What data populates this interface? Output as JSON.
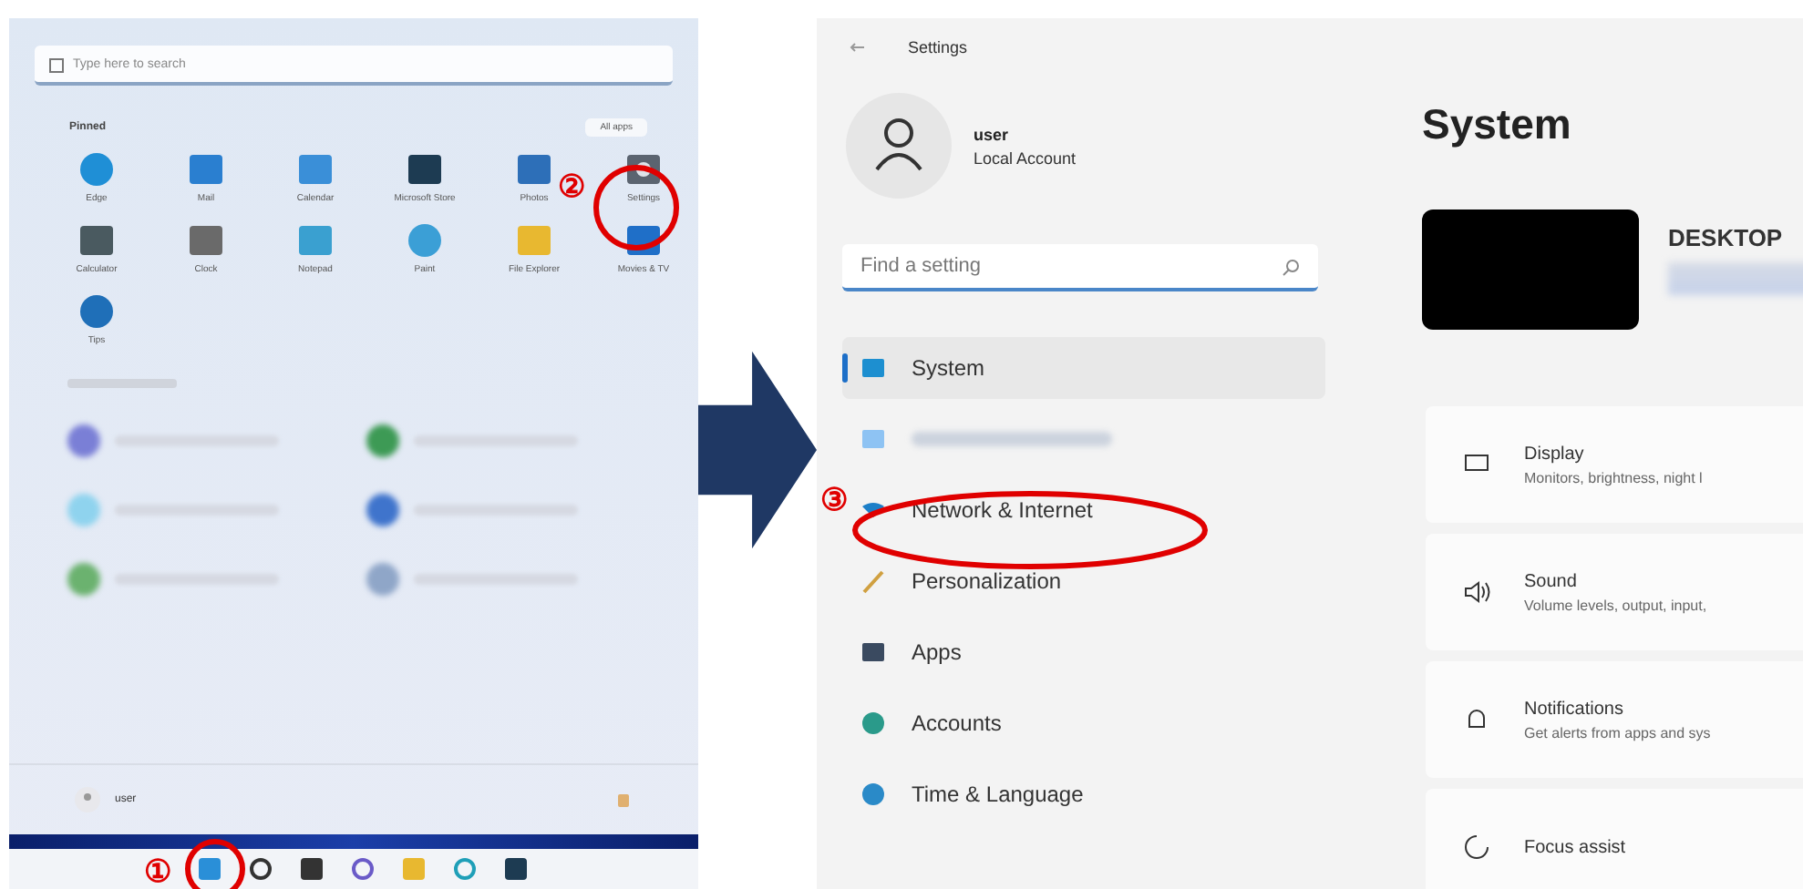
{
  "start_menu": {
    "search": {
      "placeholder": "Type here to search"
    },
    "pinned_title": "Pinned",
    "all_apps": "All apps",
    "apps": [
      {
        "label": "Edge",
        "kind": "edge"
      },
      {
        "label": "Mail",
        "kind": "mail"
      },
      {
        "label": "Calendar",
        "kind": "calendar"
      },
      {
        "label": "Microsoft Store",
        "kind": "store"
      },
      {
        "label": "Photos",
        "kind": "photos"
      },
      {
        "label": "Settings",
        "kind": "settings"
      },
      {
        "label": "Calculator",
        "kind": "calculator"
      },
      {
        "label": "Clock",
        "kind": "clock"
      },
      {
        "label": "Notepad",
        "kind": "notepad"
      },
      {
        "label": "Paint",
        "kind": "paint"
      },
      {
        "label": "File Explorer",
        "kind": "explorer"
      },
      {
        "label": "Movies & TV",
        "kind": "movies"
      },
      {
        "label": "Tips",
        "kind": "tips"
      }
    ],
    "recommended": [
      {
        "color": "#7a7fd6"
      },
      {
        "color": "#3d9a55"
      },
      {
        "color": "#8fd3ee"
      },
      {
        "color": "#3f74cc"
      },
      {
        "color": "#6bb26f"
      },
      {
        "color": "#8fa6c8"
      }
    ],
    "user": "user"
  },
  "taskbar": {
    "icons": [
      {
        "kind": "start"
      },
      {
        "kind": "search"
      },
      {
        "kind": "widgets"
      },
      {
        "kind": "chat"
      },
      {
        "kind": "explorer"
      },
      {
        "kind": "edge"
      },
      {
        "kind": "store"
      }
    ]
  },
  "settings": {
    "title": "Settings",
    "account": {
      "name": "user",
      "type": "Local Account"
    },
    "search": {
      "placeholder": "Find a setting"
    },
    "nav": [
      {
        "label": "System",
        "kind": "system",
        "selected": true
      },
      {
        "kind": "bluetooth",
        "selected": false
      },
      {
        "label": "Network & Internet",
        "kind": "network",
        "selected": false
      },
      {
        "label": "Personalization",
        "kind": "personalization",
        "selected": false
      },
      {
        "label": "Apps",
        "kind": "apps",
        "selected": false
      },
      {
        "label": "Accounts",
        "kind": "accounts",
        "selected": false
      },
      {
        "label": "Time & Language",
        "kind": "time",
        "selected": false
      }
    ],
    "page": {
      "title": "System",
      "device": "DESKTOP",
      "cards": [
        {
          "kind": "display",
          "title": "Display",
          "subtitle": "Monitors, brightness, night l"
        },
        {
          "kind": "sound",
          "title": "Sound",
          "subtitle": "Volume levels, output, input,"
        },
        {
          "kind": "notifications",
          "title": "Notifications",
          "subtitle": "Get alerts from apps and sys"
        },
        {
          "kind": "focus",
          "title": "Focus assist"
        }
      ]
    }
  },
  "annotations": [
    "①",
    "②",
    "③"
  ]
}
